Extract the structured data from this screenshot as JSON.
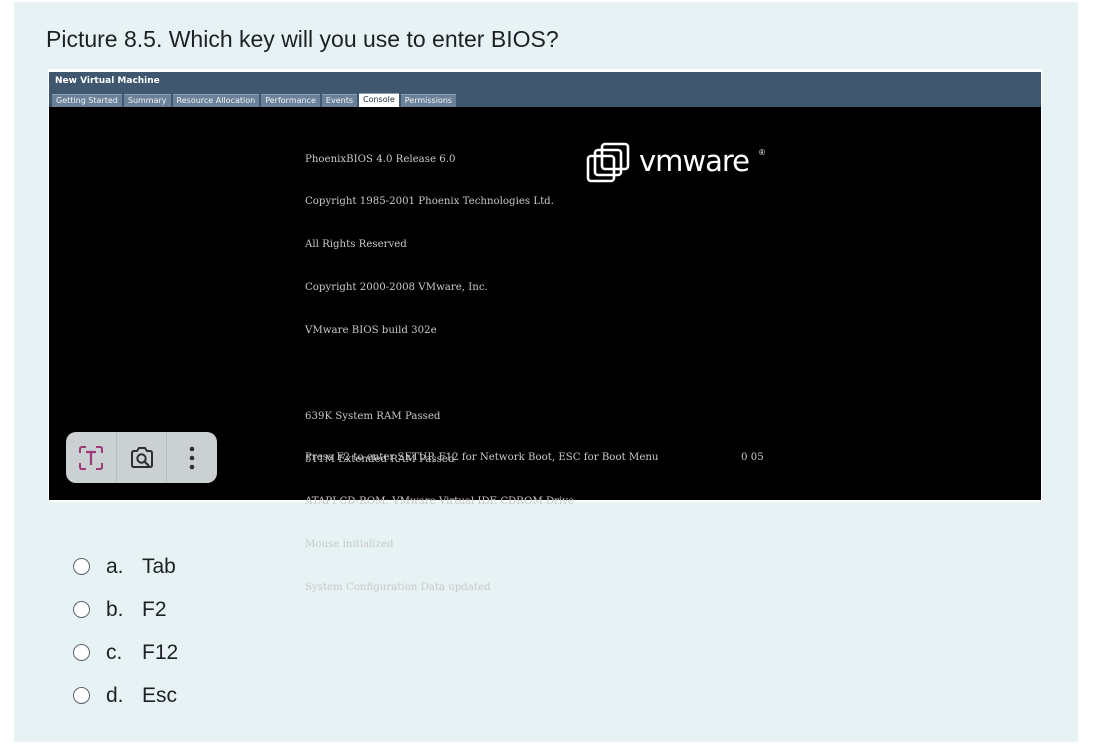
{
  "question": {
    "text": "Picture 8.5. Which key will you use to enter BIOS?"
  },
  "vm": {
    "title": "New Virtual Machine",
    "tabs": [
      "Getting Started",
      "Summary",
      "Resource Allocation",
      "Performance",
      "Events",
      "Console",
      "Permissions"
    ],
    "active_tab": "Console",
    "bios_lines_1": [
      "PhoenixBIOS 4.0 Release 6.0",
      "Copyright 1985-2001 Phoenix Technologies Ltd.",
      "All Rights Reserved",
      "Copyright 2000-2008 VMware, Inc.",
      "VMware BIOS build 302e"
    ],
    "bios_lines_2": [
      "639K System RAM Passed",
      "511M Extended RAM Passed",
      "ATAPI CD-ROM: VMware Virtual IDE CDROM Drive",
      "Mouse initialized",
      "System Configuration Data updated"
    ],
    "press_line": "Press F2 to enter SETUP, F12 for Network Boot, ESC for Boot Menu",
    "counter": "0 05",
    "logo_text": "vmware",
    "logo_reg": "®"
  },
  "toolbar": {
    "icons": [
      "text-extract-icon",
      "visual-search-icon",
      "more-options-icon"
    ]
  },
  "options": [
    {
      "letter": "a.",
      "text": "Tab"
    },
    {
      "letter": "b.",
      "text": "F2"
    },
    {
      "letter": "c.",
      "text": "F12"
    },
    {
      "letter": "d.",
      "text": "Esc"
    }
  ],
  "colors": {
    "card_bg": "#e7f2f4",
    "titlebar": "#3f5870",
    "console_bg": "#000000",
    "console_text": "#c8c8c8",
    "toolbar_bg": "#cbd0d3",
    "text_extract_accent": "#a0397a"
  }
}
